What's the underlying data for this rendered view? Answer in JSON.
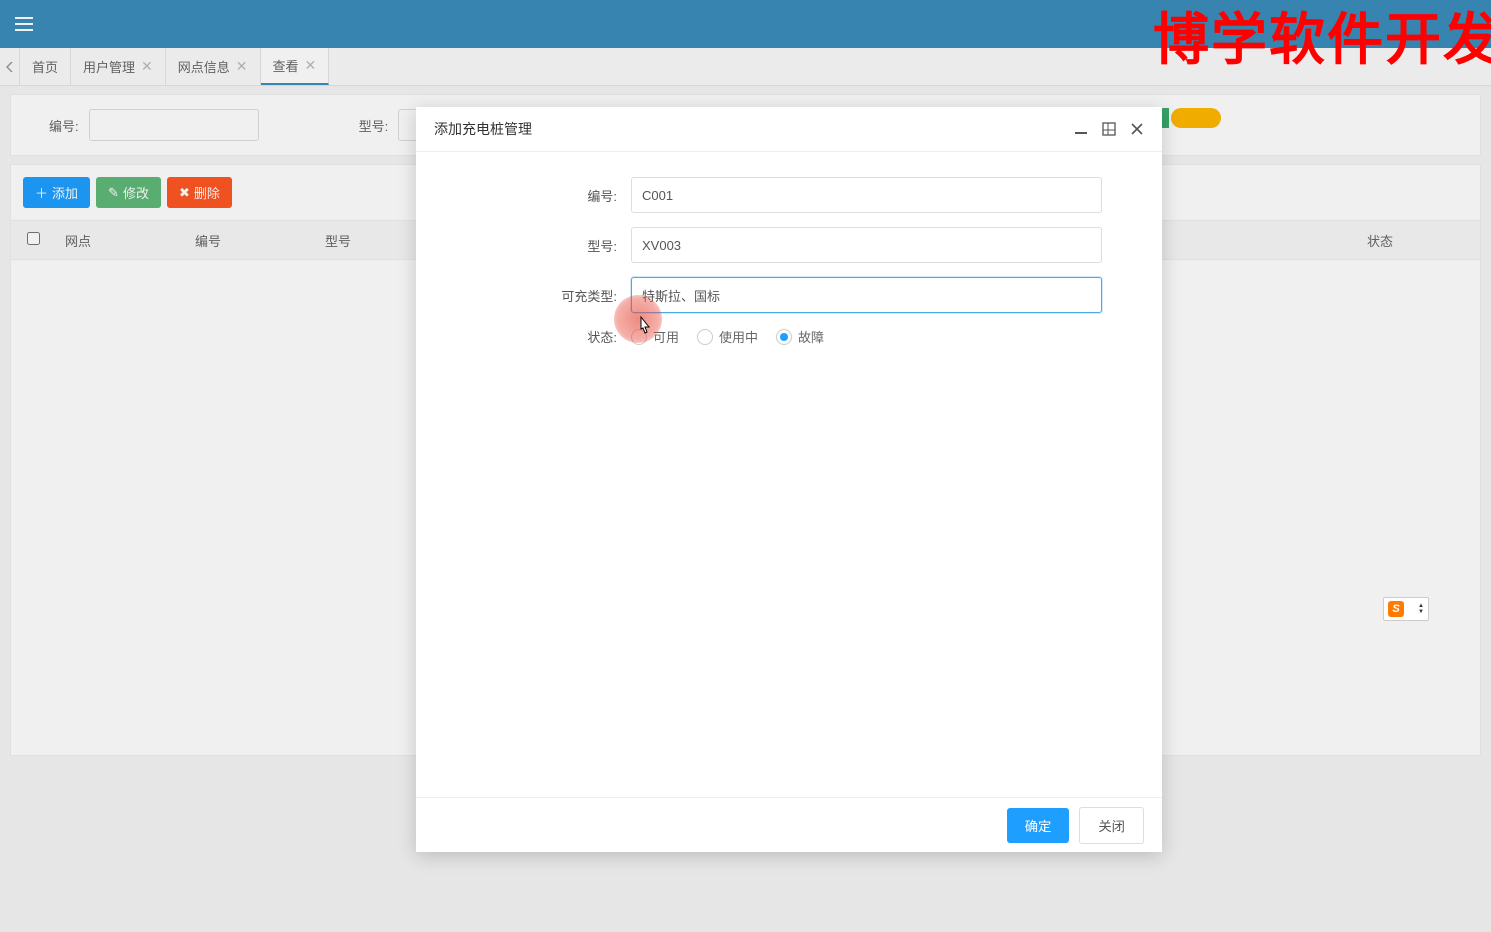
{
  "watermark": "博学软件开发",
  "tabs": {
    "home": "首页",
    "user_mgmt": "用户管理",
    "branch_info": "网点信息",
    "view": "查看"
  },
  "filter": {
    "code_label": "编号:",
    "model_label": "型号:"
  },
  "toolbar": {
    "add": "添加",
    "edit": "修改",
    "del": "删除"
  },
  "table": {
    "col_branch": "网点",
    "col_code": "编号",
    "col_model": "型号",
    "col_status": "状态"
  },
  "dialog": {
    "title": "添加充电桩管理",
    "code_label": "编号:",
    "code_value": "C001",
    "model_label": "型号:",
    "model_value": "XV003",
    "type_label": "可充类型:",
    "type_value": "特斯拉、国标",
    "status_label": "状态:",
    "status_opt1": "可用",
    "status_opt2": "使用中",
    "status_opt3": "故障",
    "ok": "确定",
    "cancel": "关闭"
  },
  "ime": {
    "letter": "S"
  }
}
